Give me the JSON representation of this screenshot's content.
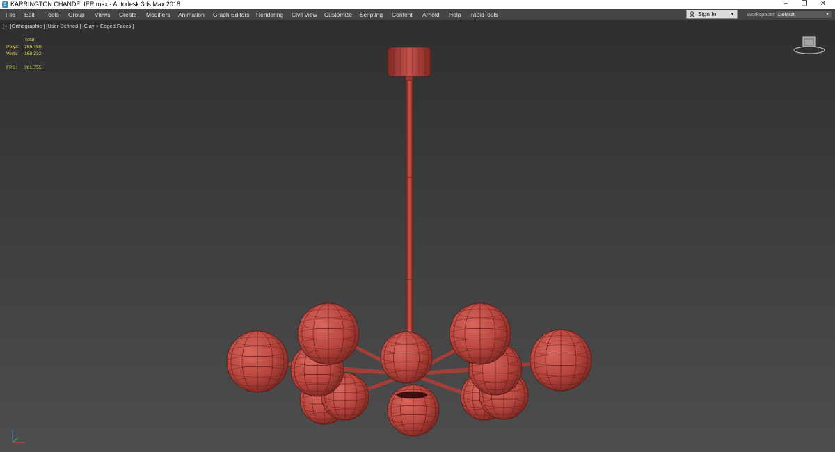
{
  "window": {
    "title": "KARRINGTON CHANDELIER.max - Autodesk 3ds Max 2018",
    "app_icon_text": "3",
    "minimize_glyph": "–",
    "maximize_glyph": "❐",
    "close_glyph": "✕"
  },
  "menu": {
    "items": [
      "File",
      "Edit",
      "Tools",
      "Group",
      "Views",
      "Create",
      "Modifiers",
      "Animation",
      "Graph Editors",
      "Rendering",
      "Civil View",
      "Customize",
      "Scripting",
      "Content",
      "Arnold",
      "Help",
      "rapidTools"
    ],
    "sign_in": "Sign In",
    "workspaces_label": "Workspaces:",
    "workspace_value": "Default"
  },
  "viewport": {
    "label": "[+] [Orthographic ] [User Defined ] [Clay + Edged Faces ]",
    "stats": {
      "header": "Total",
      "polys_label": "Polys:",
      "polys_value": "166 480",
      "verts_label": "Verts:",
      "verts_value": "169 232",
      "fps_label": "FPS:",
      "fps_value": "361,755"
    },
    "model_color": "#b8463e",
    "edge_color": "#5a1a16"
  }
}
